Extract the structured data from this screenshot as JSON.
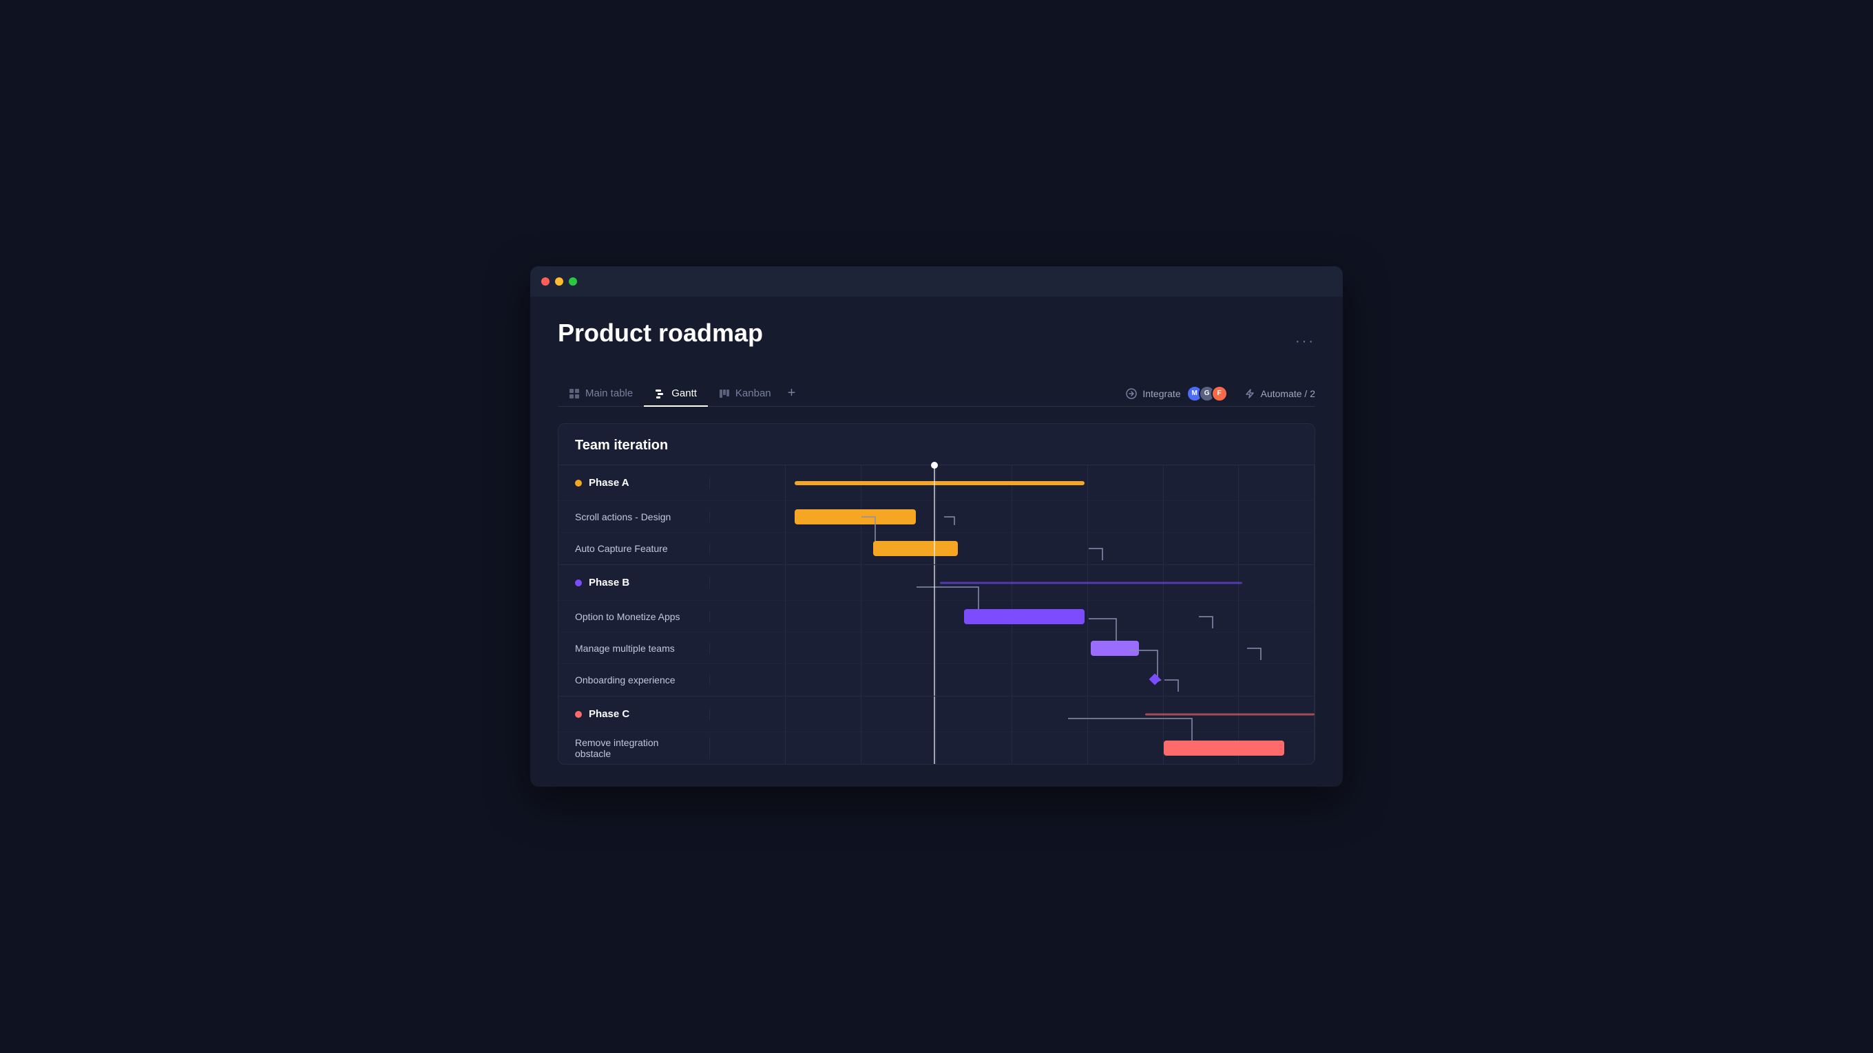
{
  "window": {
    "title": "Product roadmap"
  },
  "tabs": [
    {
      "id": "main-table",
      "label": "Main table",
      "icon": "table-icon",
      "active": false
    },
    {
      "id": "gantt",
      "label": "Gantt",
      "icon": "gantt-icon",
      "active": true
    },
    {
      "id": "kanban",
      "label": "Kanban",
      "icon": "kanban-icon",
      "active": false
    }
  ],
  "toolbar": {
    "add_label": "+",
    "integrate_label": "Integrate",
    "automate_label": "Automate / 2"
  },
  "board": {
    "title": "Team iteration"
  },
  "phases": [
    {
      "id": "phase-a",
      "label": "Phase A",
      "dot_color": "orange",
      "tasks": [
        {
          "label": "Scroll actions - Design"
        },
        {
          "label": "Auto Capture Feature"
        }
      ]
    },
    {
      "id": "phase-b",
      "label": "Phase B",
      "dot_color": "purple",
      "tasks": [
        {
          "label": "Option to Monetize Apps"
        },
        {
          "label": "Manage multiple teams"
        },
        {
          "label": "Onboarding experience"
        }
      ]
    },
    {
      "id": "phase-c",
      "label": "Phase C",
      "dot_color": "red",
      "tasks": [
        {
          "label": "Remove integration obstacle"
        }
      ]
    }
  ],
  "colors": {
    "orange": "#f5a623",
    "purple": "#7c4dff",
    "red": "#ff6b6b",
    "bg_dark": "#161b2e",
    "bg_board": "#1a1f35"
  }
}
